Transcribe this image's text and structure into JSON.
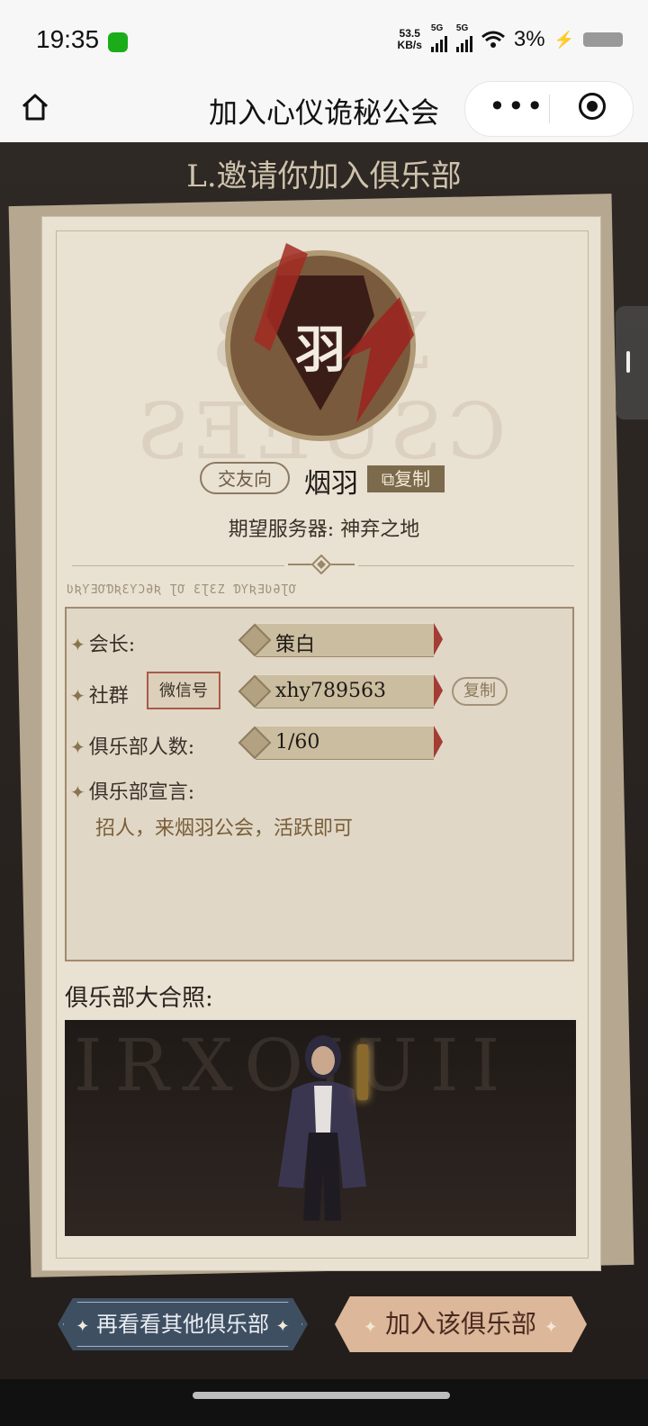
{
  "status_bar": {
    "time": "19:35",
    "speed": "53.5",
    "speed_unit": "KB/s",
    "net1": "5G",
    "net2": "5G",
    "battery": "3%"
  },
  "nav": {
    "title": "加入心仪诡秘公会",
    "more_label": "•••"
  },
  "page": {
    "heading": "L.邀请你加入俱乐部"
  },
  "club": {
    "emblem_char": "羽",
    "tag": "交友向",
    "name": "烟羽",
    "copy_label": "复制",
    "server_label": "期望服务器:",
    "server_value": "神弃之地",
    "leader_label": "会长:",
    "leader_value": "策白",
    "group_label": "社群",
    "group_type": "微信号",
    "group_value": "xhy789563",
    "group_copy": "复制",
    "members_label": "俱乐部人数:",
    "members_value": "1/60",
    "declaration_label": "俱乐部宣言:",
    "declaration_value": "招人，来烟羽公会，活跃即可",
    "photo_label": "俱乐部大合照:"
  },
  "buttons": {
    "other_clubs": "再看看其他俱乐部",
    "join": "加入该俱乐部"
  },
  "colors": {
    "accent": "#7c6a4c",
    "left_button": "#3f4f62",
    "right_button": "#dcb79a"
  }
}
